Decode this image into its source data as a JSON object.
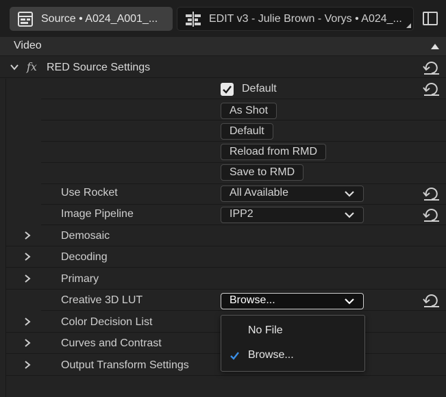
{
  "tabs": [
    {
      "label": "Source • A024_A001_...",
      "icon": "source-clip-icon",
      "active": true
    },
    {
      "label": "EDIT v3 - Julie Brown - Vorys • A024_...",
      "icon": "timeline-icon",
      "active": false
    }
  ],
  "panel_toggle_icon": "panel-toggle-icon",
  "section": {
    "label": "Video"
  },
  "effect": {
    "fx_symbol": "fx",
    "title": "RED Source Settings"
  },
  "default_checkbox": {
    "label": "Default",
    "checked": true
  },
  "buttons": {
    "as_shot": "As Shot",
    "default": "Default",
    "reload": "Reload from RMD",
    "save": "Save to RMD"
  },
  "use_rocket": {
    "label": "Use Rocket",
    "value": "All Available"
  },
  "image_pipeline": {
    "label": "Image Pipeline",
    "value": "IPP2"
  },
  "groups": {
    "demosaic": "Demosaic",
    "decoding": "Decoding",
    "primary": "Primary",
    "color_decision_list": "Color Decision List",
    "curves_and_contrast": "Curves and Contrast",
    "output_transform": "Output Transform Settings"
  },
  "creative_lut": {
    "label": "Creative 3D LUT",
    "value": "Browse..."
  },
  "lut_menu": {
    "items": [
      {
        "label": "No File",
        "selected": false
      },
      {
        "label": "Browse...",
        "selected": true
      }
    ]
  },
  "colors": {
    "background": "#232323",
    "tab_active": "#3f3f3f",
    "accent_check": "#3a8ee6"
  }
}
